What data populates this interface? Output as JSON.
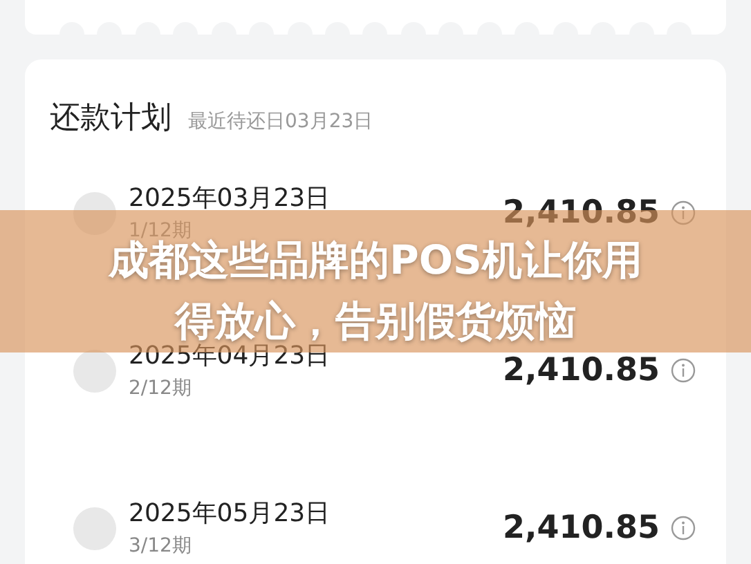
{
  "plan": {
    "title": "还款计划",
    "subtitle": "最近待还日03月23日",
    "rows": [
      {
        "date": "2025年03月23日",
        "term": "1/12期",
        "amount": "2,410.85"
      },
      {
        "date": "2025年04月23日",
        "term": "2/12期",
        "amount": "2,410.85"
      },
      {
        "date": "2025年05月23日",
        "term": "3/12期",
        "amount": "2,410.85"
      }
    ]
  },
  "banner": {
    "lines": [
      "成都这些品牌的POS机让你用",
      "得放心，告别假货烦恼"
    ]
  }
}
